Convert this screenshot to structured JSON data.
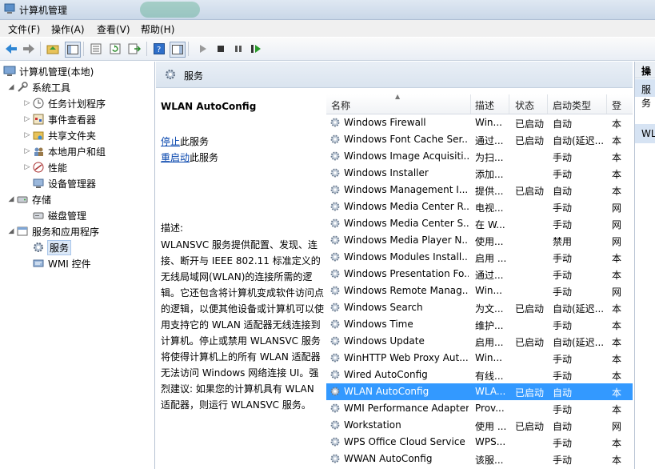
{
  "window": {
    "title": "计算机管理"
  },
  "menu": [
    "文件(F)",
    "操作(A)",
    "查看(V)",
    "帮助(H)"
  ],
  "tree": {
    "root": "计算机管理(本地)",
    "system_tools": "系统工具",
    "task_scheduler": "任务计划程序",
    "event_viewer": "事件查看器",
    "shared_folders": "共享文件夹",
    "local_users": "本地用户和组",
    "performance": "性能",
    "device_manager": "设备管理器",
    "storage": "存储",
    "disk_management": "磁盘管理",
    "services_apps": "服务和应用程序",
    "services": "服务",
    "wmi": "WMI 控件"
  },
  "panel": {
    "title": "服务"
  },
  "description": {
    "service_name": "WLAN AutoConfig",
    "stop_link": "停止",
    "stop_suffix": "此服务",
    "restart_link": "重启动",
    "restart_suffix": "此服务",
    "desc_label": "描述:",
    "desc_text": "WLANSVC 服务提供配置、发现、连接、断开与 IEEE 802.11 标准定义的无线局域网(WLAN)的连接所需的逻辑。它还包含将计算机变成软件访问点的逻辑，以便其他设备或计算机可以使用支持它的 WLAN 适配器无线连接到计算机。停止或禁用 WLANSVC 服务将使得计算机上的所有 WLAN 适配器无法访问 Windows 网络连接 UI。强烈建议: 如果您的计算机具有 WLAN 适配器，则运行 WLANSVC 服务。"
  },
  "columns": {
    "name": "名称",
    "desc": "描述",
    "status": "状态",
    "startup": "启动类型",
    "logon": "登"
  },
  "services": [
    {
      "name": "Windows Firewall",
      "desc": "Win...",
      "status": "已启动",
      "startup": "自动",
      "logon": "本"
    },
    {
      "name": "Windows Font Cache Ser...",
      "desc": "通过...",
      "status": "已启动",
      "startup": "自动(延迟...",
      "logon": "本"
    },
    {
      "name": "Windows Image Acquisiti...",
      "desc": "为扫...",
      "status": "",
      "startup": "手动",
      "logon": "本"
    },
    {
      "name": "Windows Installer",
      "desc": "添加...",
      "status": "",
      "startup": "手动",
      "logon": "本"
    },
    {
      "name": "Windows Management I...",
      "desc": "提供...",
      "status": "已启动",
      "startup": "自动",
      "logon": "本"
    },
    {
      "name": "Windows Media Center R...",
      "desc": "电视...",
      "status": "",
      "startup": "手动",
      "logon": "网"
    },
    {
      "name": "Windows Media Center S...",
      "desc": "在 W...",
      "status": "",
      "startup": "手动",
      "logon": "网"
    },
    {
      "name": "Windows Media Player N...",
      "desc": "使用...",
      "status": "",
      "startup": "禁用",
      "logon": "网"
    },
    {
      "name": "Windows Modules Install...",
      "desc": "启用 ...",
      "status": "",
      "startup": "手动",
      "logon": "本"
    },
    {
      "name": "Windows Presentation Fo...",
      "desc": "通过...",
      "status": "",
      "startup": "手动",
      "logon": "本"
    },
    {
      "name": "Windows Remote Manag...",
      "desc": "Win...",
      "status": "",
      "startup": "手动",
      "logon": "网"
    },
    {
      "name": "Windows Search",
      "desc": "为文...",
      "status": "已启动",
      "startup": "自动(延迟...",
      "logon": "本"
    },
    {
      "name": "Windows Time",
      "desc": "维护...",
      "status": "",
      "startup": "手动",
      "logon": "本"
    },
    {
      "name": "Windows Update",
      "desc": "启用...",
      "status": "已启动",
      "startup": "自动(延迟...",
      "logon": "本"
    },
    {
      "name": "WinHTTP Web Proxy Aut...",
      "desc": "Win...",
      "status": "",
      "startup": "手动",
      "logon": "本"
    },
    {
      "name": "Wired AutoConfig",
      "desc": "有线...",
      "status": "",
      "startup": "手动",
      "logon": "本"
    },
    {
      "name": "WLAN AutoConfig",
      "desc": "WLA...",
      "status": "已启动",
      "startup": "自动",
      "logon": "本"
    },
    {
      "name": "WMI Performance Adapter",
      "desc": "Prov...",
      "status": "",
      "startup": "手动",
      "logon": "本"
    },
    {
      "name": "Workstation",
      "desc": "使用 ...",
      "status": "已启动",
      "startup": "自动",
      "logon": "网"
    },
    {
      "name": "WPS Office Cloud Service",
      "desc": "WPS...",
      "status": "",
      "startup": "手动",
      "logon": "本"
    },
    {
      "name": "WWAN AutoConfig",
      "desc": "该服...",
      "status": "",
      "startup": "手动",
      "logon": "本"
    }
  ],
  "actions": {
    "header": "操作",
    "item1": "服务",
    "item2": "WLAN"
  },
  "colors": {
    "selection": "#3399ff",
    "link": "#0645ad"
  }
}
